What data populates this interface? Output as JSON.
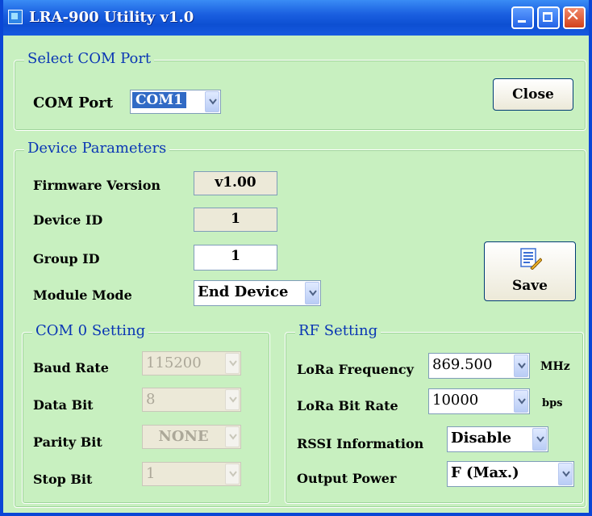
{
  "window": {
    "title": "LRA-900 Utility v1.0"
  },
  "com_port_group": {
    "legend": "Select COM Port",
    "label": "COM Port",
    "selected": "COM1",
    "close_label": "Close"
  },
  "device_params": {
    "legend": "Device Parameters",
    "firmware_label": "Firmware Version",
    "firmware_value": "v1.00",
    "device_id_label": "Device ID",
    "device_id_value": "1",
    "group_id_label": "Group ID",
    "group_id_value": "1",
    "module_mode_label": "Module Mode",
    "module_mode_value": "End Device",
    "save_label": "Save"
  },
  "com0_setting": {
    "legend": "COM 0 Setting",
    "baud_label": "Baud Rate",
    "baud_value": "115200",
    "data_bit_label": "Data Bit",
    "data_bit_value": "8",
    "parity_label": "Parity Bit",
    "parity_value": "NONE",
    "stop_bit_label": "Stop Bit",
    "stop_bit_value": "1"
  },
  "rf_setting": {
    "legend": "RF Setting",
    "freq_label": "LoRa Frequency",
    "freq_value": "869.500",
    "freq_unit": "MHz",
    "bitrate_label": "LoRa Bit Rate",
    "bitrate_value": "10000",
    "bitrate_unit": "bps",
    "rssi_label": "RSSI Information",
    "rssi_value": "Disable",
    "power_label": "Output Power",
    "power_value": "F (Max.)"
  },
  "colors": {
    "window_bg": "#c8f0c0",
    "titlebar": "#0d4fd2",
    "legend_text": "#0a36b4"
  },
  "icons": [
    "app-icon",
    "minimize-icon",
    "maximize-icon",
    "close-icon",
    "dropdown-arrow-icon",
    "save-document-icon"
  ]
}
